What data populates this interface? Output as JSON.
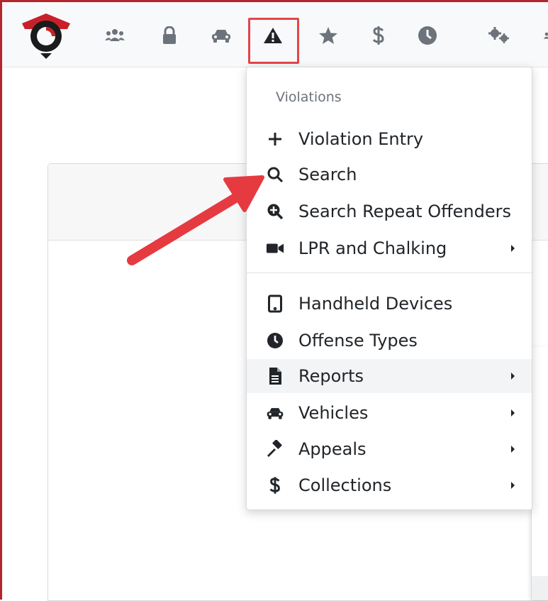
{
  "nav": {
    "icons": [
      "users-icon",
      "lock-icon",
      "car-icon",
      "warning-icon",
      "star-icon",
      "dollar-icon",
      "clock-icon",
      "gears-icon",
      "user-icon"
    ],
    "active": "warning-icon"
  },
  "violations_menu": {
    "header": "Violations",
    "items": [
      {
        "label": "Violation Entry",
        "icon": "plus-icon",
        "submenu": false
      },
      {
        "label": "Search",
        "icon": "search-icon",
        "submenu": false
      },
      {
        "label": "Search Repeat Offenders",
        "icon": "search-plus-icon",
        "submenu": false
      },
      {
        "label": "LPR and Chalking",
        "icon": "video-icon",
        "submenu": true
      },
      {
        "label": "Handheld Devices",
        "icon": "tablet-icon",
        "submenu": false
      },
      {
        "label": "Offense Types",
        "icon": "clock-icon",
        "submenu": false
      },
      {
        "label": "Reports",
        "icon": "file-icon",
        "submenu": true
      },
      {
        "label": "Vehicles",
        "icon": "car-icon",
        "submenu": true
      },
      {
        "label": "Appeals",
        "icon": "gavel-icon",
        "submenu": true
      },
      {
        "label": "Collections",
        "icon": "dollar-icon",
        "submenu": true
      }
    ]
  },
  "colors": {
    "highlight_box": "#e4454b",
    "annotation_arrow": "#e53a40",
    "logo_red": "#c8202a",
    "frame": "#b3262c"
  }
}
